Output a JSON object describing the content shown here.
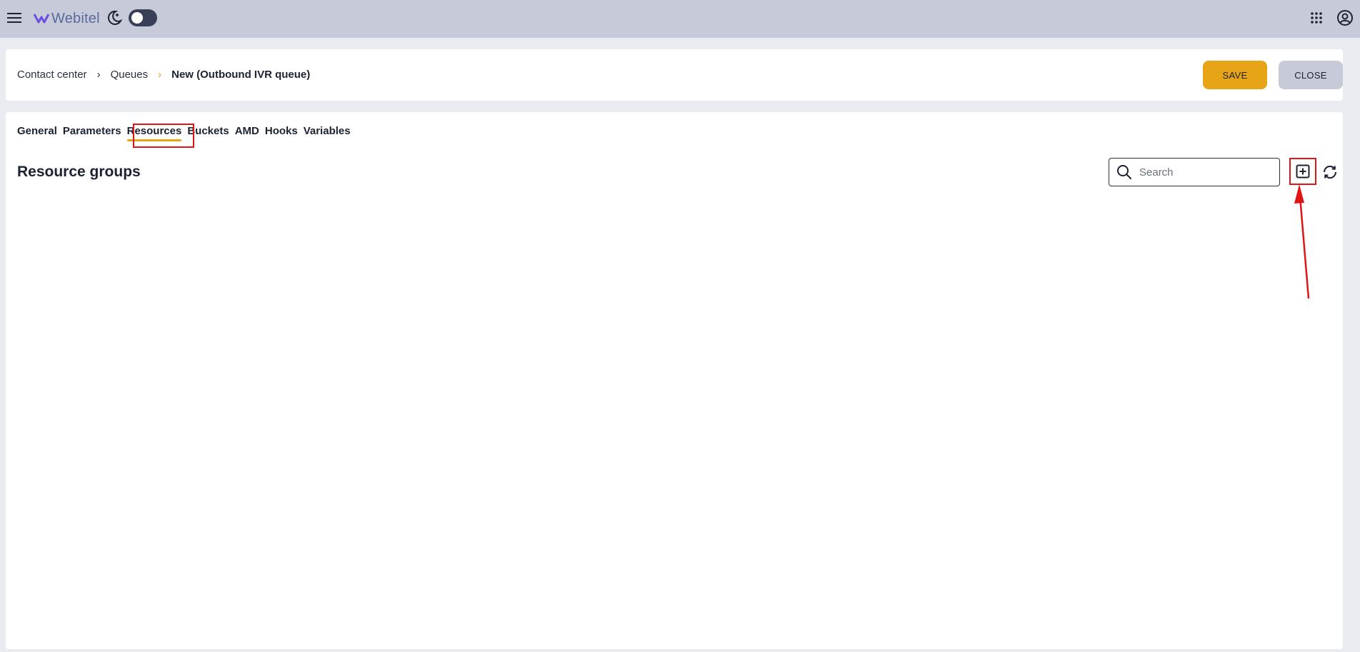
{
  "app": {
    "brand": "Webitel"
  },
  "header": {
    "breadcrumb": [
      "Contact center",
      "Queues",
      "New (Outbound IVR queue)"
    ],
    "save_label": "SAVE",
    "close_label": "CLOSE"
  },
  "tabs": [
    {
      "label": "General"
    },
    {
      "label": "Parameters"
    },
    {
      "label": "Resources",
      "active": true
    },
    {
      "label": "Buckets"
    },
    {
      "label": "AMD"
    },
    {
      "label": "Hooks"
    },
    {
      "label": "Variables"
    }
  ],
  "section": {
    "title": "Resource groups"
  },
  "search": {
    "placeholder": "Search"
  },
  "icons": {
    "menu": "hamburger-icon",
    "theme": "moon-icon",
    "apps": "grid-icon",
    "account": "account-circle-icon",
    "search": "search-icon",
    "add": "plus-square-icon",
    "refresh": "refresh-icon"
  },
  "colors": {
    "accent": "#e6a416",
    "topbar": "#c7cbd9",
    "annotation": "#e01515"
  }
}
